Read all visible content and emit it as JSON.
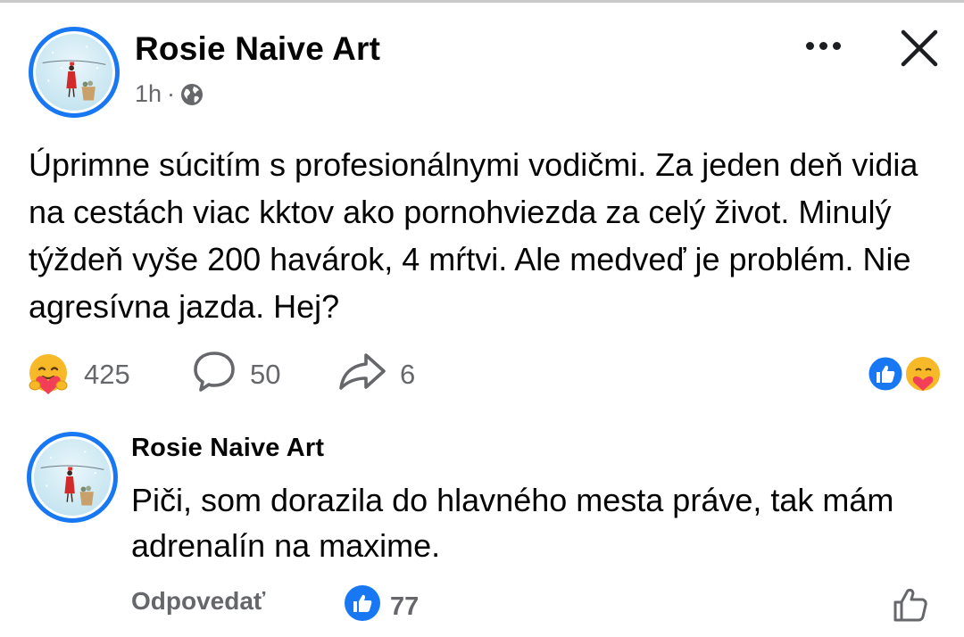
{
  "post": {
    "author": "Rosie Naive Art",
    "time": "1h",
    "separator": "·",
    "privacy_icon": "globe-icon",
    "text": "Úprimne súcitím s profesionálnymi vodičmi. Za jeden deň vidia na cestách viac kktov ako pornohviezda za celý život. Minulý týždeň vyše 200 havárok, 4 mŕtvi. Ale medveď je problém. Nie agresívna jazda. Hej?",
    "reaction_count": "425",
    "comment_count": "50",
    "share_count": "6"
  },
  "comment": {
    "author": "Rosie Naive Art",
    "text": "Piči, som dorazila do hlavného mesta práve, tak mám adrenalín na maxime.",
    "reply_label": "Odpovedať",
    "like_count": "77"
  },
  "colors": {
    "brand_blue": "#1877f2",
    "muted_text": "#65676b",
    "care_yellow": "#f7b928",
    "care_heart": "#f33e58"
  }
}
